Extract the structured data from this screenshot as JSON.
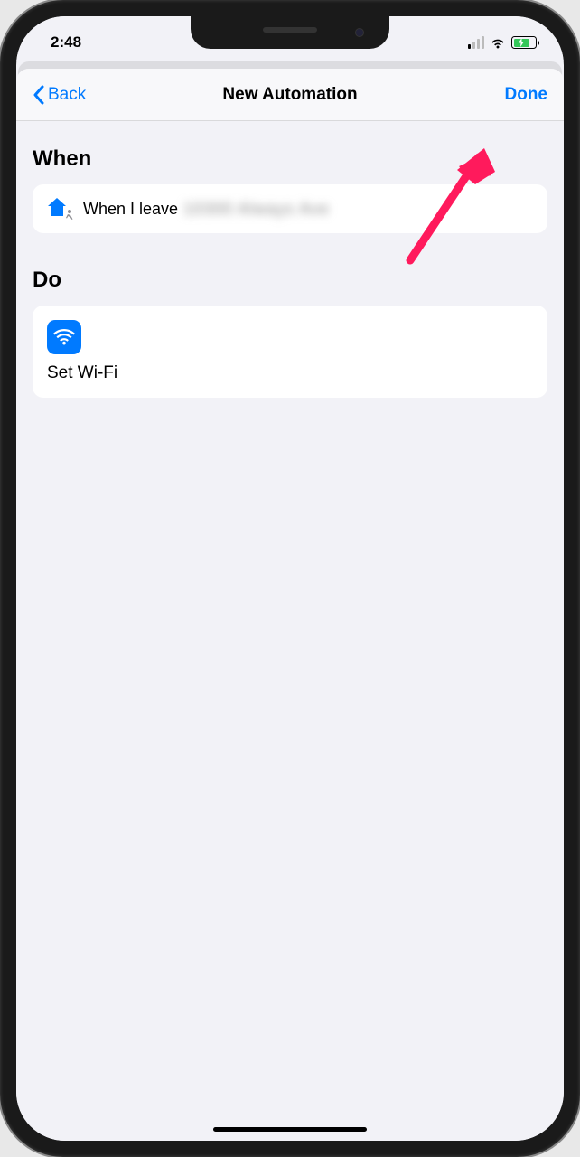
{
  "status_bar": {
    "time": "2:48"
  },
  "nav": {
    "back_label": "Back",
    "title": "New Automation",
    "done_label": "Done"
  },
  "sections": {
    "when": {
      "header": "When",
      "row": {
        "prefix": "When I leave ",
        "redacted": "10300 Always Ave"
      }
    },
    "do": {
      "header": "Do",
      "action_label": "Set Wi-Fi"
    }
  }
}
